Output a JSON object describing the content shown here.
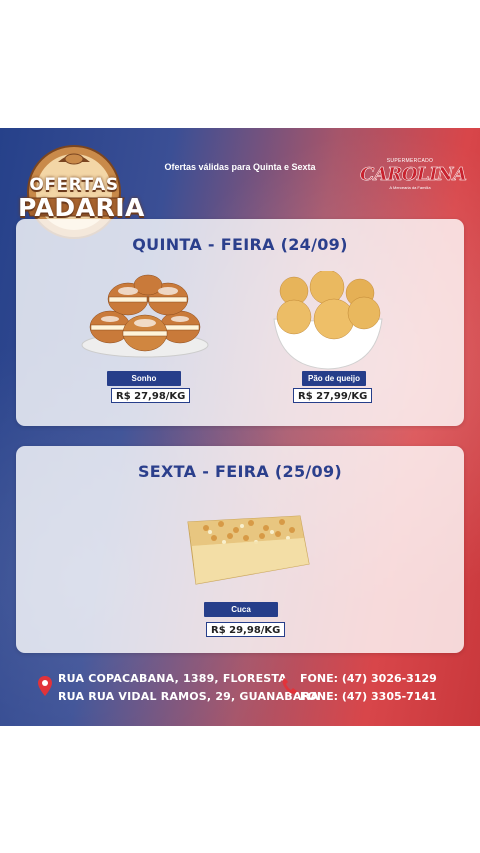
{
  "header": {
    "logo_top": "OFERTAS",
    "logo_bottom": "PADARIA",
    "logo_colors": {
      "outer": "#c98a4a",
      "inner": "#f3d6a6",
      "text_shadow": "#6b3a1c"
    },
    "validity": "Ofertas válidas para Quinta e Sexta",
    "brand_small": "SUPERMERCADO",
    "brand_name": "CAROLINA",
    "brand_tag": "A Mercearia da Família"
  },
  "sections": [
    {
      "title": "QUINTA - FEIRA (24/09)",
      "products": [
        {
          "name": "Sonho",
          "price": "R$ 27,98/KG",
          "image": "sonho-image"
        },
        {
          "name": "Pão de queijo",
          "price": "R$ 27,99/KG",
          "image": "pao-de-queijo-image"
        }
      ]
    },
    {
      "title": "SEXTA - FEIRA (25/09)",
      "products": [
        {
          "name": "Cuca",
          "price": "R$ 29,98/KG",
          "image": "cuca-image"
        }
      ]
    }
  ],
  "footer": {
    "addresses": [
      "RUA COPACABANA, 1389, FLORESTA",
      "RUA RUA VIDAL RAMOS, 29, GUANABARA"
    ],
    "phones": [
      "FONE: (47) 3026-3129",
      "FONE: (47) 3305-7141"
    ],
    "icons": {
      "address": "map-pin-icon",
      "phone": "phone-icon"
    }
  },
  "colors": {
    "blue": "#263e8a",
    "red": "#d8464a",
    "title_blue": "#2b3f8c",
    "brand_red": "#c8232f"
  }
}
